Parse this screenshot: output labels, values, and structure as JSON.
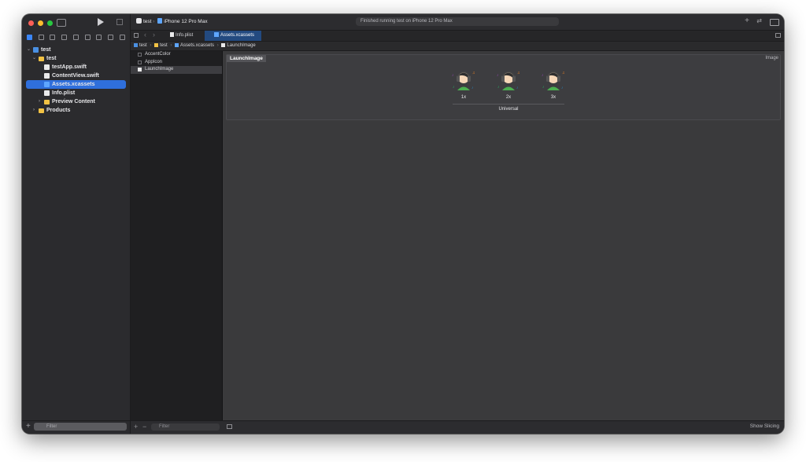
{
  "sidebar": {
    "tree": [
      {
        "label": "test",
        "level": 0,
        "icon": "project-icon",
        "chevron": "down"
      },
      {
        "label": "test",
        "level": 1,
        "icon": "folder-icon",
        "chevron": "down"
      },
      {
        "label": "testApp.swift",
        "level": 2,
        "icon": "swift-file-icon"
      },
      {
        "label": "ContentView.swift",
        "level": 2,
        "icon": "swift-file-icon"
      },
      {
        "label": "Assets.xcassets",
        "level": 2,
        "icon": "asset-catalog-icon",
        "selected": true
      },
      {
        "label": "Info.plist",
        "level": 2,
        "icon": "plist-file-icon"
      },
      {
        "label": "Preview Content",
        "level": 2,
        "icon": "folder-icon",
        "chevron": "right"
      },
      {
        "label": "Products",
        "level": 1,
        "icon": "folder-icon",
        "chevron": "right"
      }
    ],
    "filter_placeholder": "Filter"
  },
  "toolbar": {
    "scheme": "test",
    "destination": "iPhone 12 Pro Max",
    "status": "Finished running test on iPhone 12 Pro Max"
  },
  "tabs": [
    {
      "label": "Info.plist",
      "active": false
    },
    {
      "label": "Assets.xcassets",
      "active": true
    }
  ],
  "jumpbar": [
    "test",
    "test",
    "Assets.xcassets",
    "LaunchImage"
  ],
  "asset_list": [
    {
      "label": "AccentColor",
      "selected": false
    },
    {
      "label": "AppIcon",
      "selected": false
    },
    {
      "label": "LaunchImage",
      "selected": true
    }
  ],
  "editor": {
    "set_name": "LaunchImage",
    "set_kind": "Image",
    "slots": [
      "1x",
      "2x",
      "3x"
    ],
    "idiom": "Universal",
    "show_slicing": "Show Slicing"
  },
  "bottom": {
    "filter_placeholder": "Filter"
  },
  "colors": {
    "accent": "#2f6fdc",
    "tab_active": "#234a80",
    "folder": "#f2c244"
  }
}
